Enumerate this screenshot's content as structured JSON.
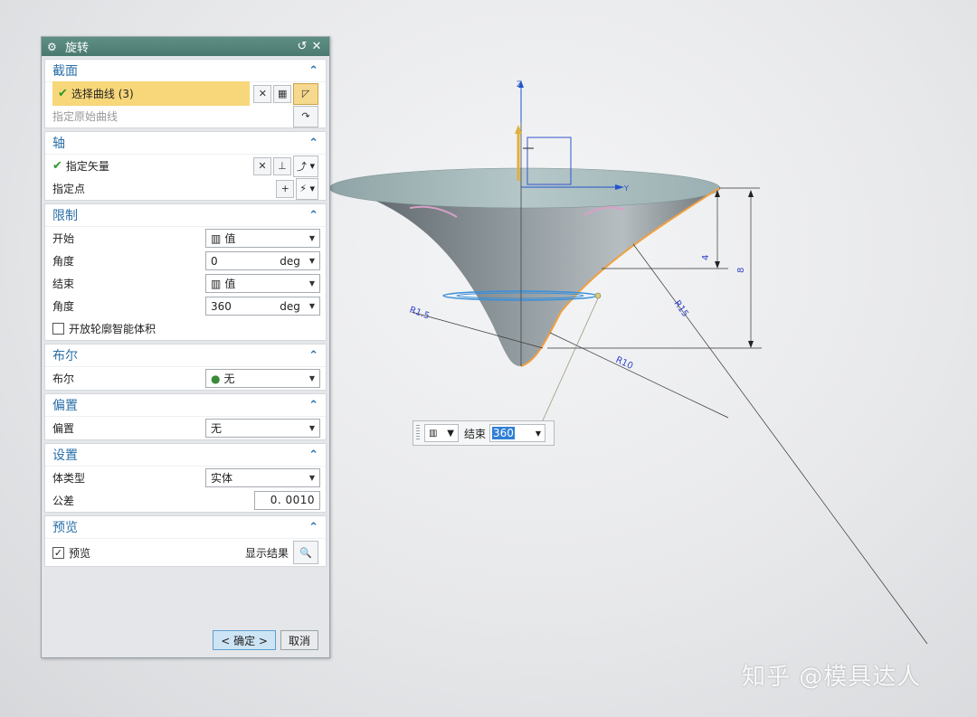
{
  "dialog": {
    "title": "旋转",
    "reset_symbol": "↺",
    "close_symbol": "✕",
    "collapse_symbol": "⌃",
    "section": {
      "title": "截面",
      "select_curve": "选择曲线 (3)",
      "specify_origin": "指定原始曲线"
    },
    "axis": {
      "title": "轴",
      "vector": "指定矢量",
      "point": "指定点"
    },
    "limits": {
      "title": "限制",
      "start_label": "开始",
      "start_value": "值",
      "start_angle_label": "角度",
      "start_angle": "0",
      "end_label": "结束",
      "end_value": "值",
      "end_angle_label": "角度",
      "end_angle": "360",
      "unit": "deg",
      "open_profile": "开放轮廓智能体积"
    },
    "boolean": {
      "title": "布尔",
      "label": "布尔",
      "value": "无"
    },
    "offset": {
      "title": "偏置",
      "label": "偏置",
      "value": "无"
    },
    "settings": {
      "title": "设置",
      "body_type_label": "体类型",
      "body_type": "实体",
      "tolerance_label": "公差",
      "tolerance": "0. 0010"
    },
    "preview": {
      "title": "预览",
      "checkbox_label": "预览",
      "show_result": "显示结果"
    },
    "ok": "< 确定 >",
    "cancel": "取消"
  },
  "handle": {
    "label": "结束",
    "value": "360"
  },
  "viewport": {
    "axis_z": "Z",
    "axis_y": "Y",
    "dims": [
      "R1.5",
      "R10",
      "R15",
      "4",
      "8"
    ]
  },
  "watermark": "知乎 @模具达人"
}
